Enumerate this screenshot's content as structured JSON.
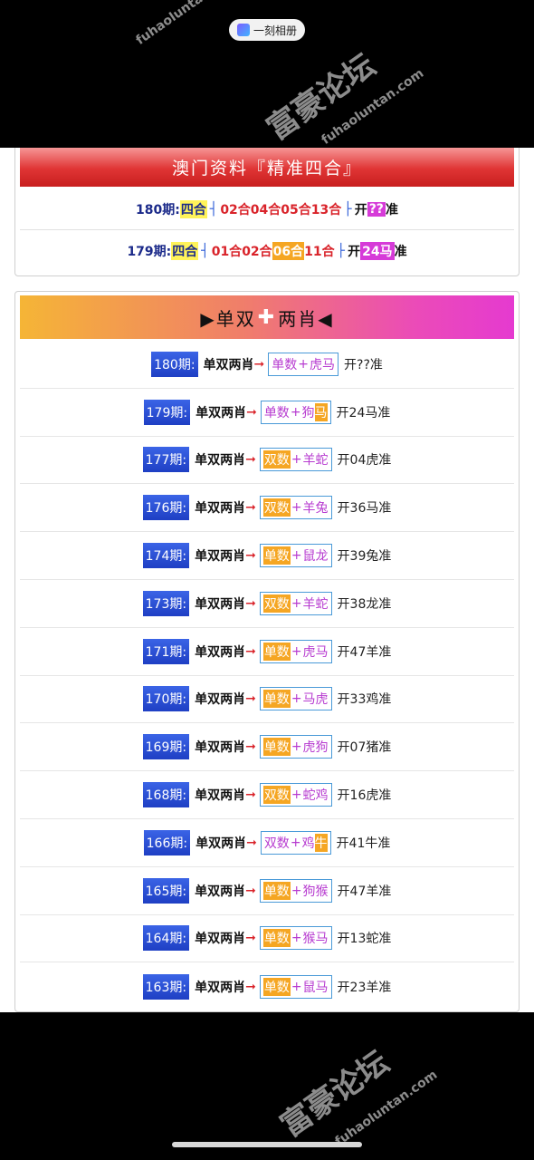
{
  "app_pill": {
    "label": "一刻相册"
  },
  "macau": {
    "title": "澳门资料『精准四合』",
    "rows": [
      {
        "period": "180期:",
        "tag": "四合",
        "nums": [
          {
            "text": "02合",
            "style": "red"
          },
          {
            "text": "04合",
            "style": "red"
          },
          {
            "text": "05合",
            "style": "red"
          },
          {
            "text": "13合",
            "style": "red"
          }
        ],
        "open_prefix": "开",
        "open_value": "??",
        "open_suffix": "准"
      },
      {
        "period": "179期:",
        "tag": "四合",
        "nums": [
          {
            "text": "01合",
            "style": "red"
          },
          {
            "text": "02合",
            "style": "red"
          },
          {
            "text": "06合",
            "style": "orange"
          },
          {
            "text": "11合",
            "style": "red"
          }
        ],
        "open_prefix": "开",
        "open_value": "24马",
        "open_suffix": "准"
      }
    ]
  },
  "danshuang": {
    "title_left": "▶单双",
    "title_right": "两肖◀",
    "cross": "✚",
    "label": "单双两肖",
    "arrow": "➞",
    "rows": [
      {
        "period": "180期:",
        "oddeven": "单数",
        "oe_hit": false,
        "z1": "虎",
        "z1_hit": false,
        "z2": "马",
        "z2_hit": false,
        "result": "开??准"
      },
      {
        "period": "179期:",
        "oddeven": "单数",
        "oe_hit": false,
        "z1": "狗",
        "z1_hit": false,
        "z2": "马",
        "z2_hit": true,
        "result": "开24马准"
      },
      {
        "period": "177期:",
        "oddeven": "双数",
        "oe_hit": true,
        "z1": "羊",
        "z1_hit": false,
        "z2": "蛇",
        "z2_hit": false,
        "result": "开04虎准"
      },
      {
        "period": "176期:",
        "oddeven": "双数",
        "oe_hit": true,
        "z1": "羊",
        "z1_hit": false,
        "z2": "兔",
        "z2_hit": false,
        "result": "开36马准"
      },
      {
        "period": "174期:",
        "oddeven": "单数",
        "oe_hit": true,
        "z1": "鼠",
        "z1_hit": false,
        "z2": "龙",
        "z2_hit": false,
        "result": "开39兔准"
      },
      {
        "period": "173期:",
        "oddeven": "双数",
        "oe_hit": true,
        "z1": "羊",
        "z1_hit": false,
        "z2": "蛇",
        "z2_hit": false,
        "result": "开38龙准"
      },
      {
        "period": "171期:",
        "oddeven": "单数",
        "oe_hit": true,
        "z1": "虎",
        "z1_hit": false,
        "z2": "马",
        "z2_hit": false,
        "result": "开47羊准"
      },
      {
        "period": "170期:",
        "oddeven": "单数",
        "oe_hit": true,
        "z1": "马",
        "z1_hit": false,
        "z2": "虎",
        "z2_hit": false,
        "result": "开33鸡准"
      },
      {
        "period": "169期:",
        "oddeven": "单数",
        "oe_hit": true,
        "z1": "虎",
        "z1_hit": false,
        "z2": "狗",
        "z2_hit": false,
        "result": "开07猪准"
      },
      {
        "period": "168期:",
        "oddeven": "双数",
        "oe_hit": true,
        "z1": "蛇",
        "z1_hit": false,
        "z2": "鸡",
        "z2_hit": false,
        "result": "开16虎准"
      },
      {
        "period": "166期:",
        "oddeven": "双数",
        "oe_hit": false,
        "z1": "鸡",
        "z1_hit": false,
        "z2": "牛",
        "z2_hit": true,
        "result": "开41牛准"
      },
      {
        "period": "165期:",
        "oddeven": "单数",
        "oe_hit": true,
        "z1": "狗",
        "z1_hit": false,
        "z2": "猴",
        "z2_hit": false,
        "result": "开47羊准"
      },
      {
        "period": "164期:",
        "oddeven": "单数",
        "oe_hit": true,
        "z1": "猴",
        "z1_hit": false,
        "z2": "马",
        "z2_hit": false,
        "result": "开13蛇准"
      },
      {
        "period": "163期:",
        "oddeven": "单数",
        "oe_hit": true,
        "z1": "鼠",
        "z1_hit": false,
        "z2": "马",
        "z2_hit": false,
        "result": "开23羊准"
      }
    ]
  },
  "watermarks": {
    "brand": "富豪论坛",
    "domain": "fuhaoluntan.com"
  }
}
